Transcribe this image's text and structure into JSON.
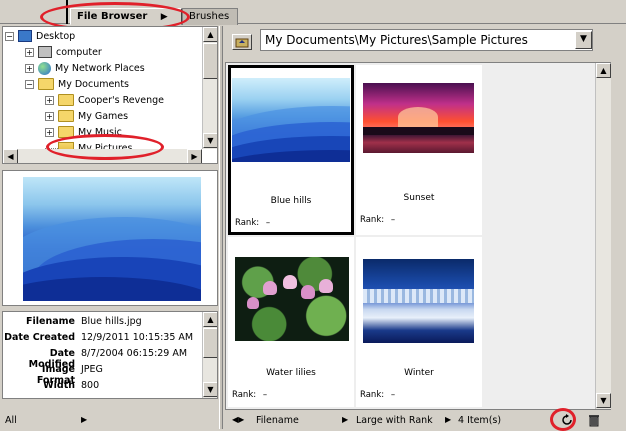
{
  "tabs": [
    {
      "label": "File Browser",
      "arrow": "▶"
    },
    {
      "label": "Brushes"
    }
  ],
  "tree": {
    "items": [
      {
        "label": "Desktop",
        "icon": "desktop-icon"
      },
      {
        "label": "computer",
        "icon": "computer-icon"
      },
      {
        "label": "My Network Places",
        "icon": "network-icon"
      },
      {
        "label": "My Documents",
        "icon": "folder-icon"
      },
      {
        "label": "Cooper's Revenge",
        "icon": "folder-icon"
      },
      {
        "label": "My Games",
        "icon": "folder-icon"
      },
      {
        "label": "My Music",
        "icon": "folder-icon"
      },
      {
        "label": "My Pictures",
        "icon": "pictures-folder-icon"
      }
    ]
  },
  "path": {
    "value": "My Documents\\My Pictures\\Sample Pictures"
  },
  "metadata": [
    {
      "key": "Filename",
      "value": "Blue hills.jpg"
    },
    {
      "key": "Date Created",
      "value": "12/9/2011 10:15:35 AM"
    },
    {
      "key": "Date Modified",
      "value": "8/7/2004 06:15:29 AM"
    },
    {
      "key": "Image Format",
      "value": "JPEG"
    },
    {
      "key": "Width",
      "value": "800"
    }
  ],
  "left_status": {
    "label": "All",
    "arrow": "▶"
  },
  "thumbnails": [
    {
      "caption": "Blue hills",
      "rank_label": "Rank:",
      "rank_value": "–",
      "selected": true
    },
    {
      "caption": "Sunset",
      "rank_label": "Rank:",
      "rank_value": "–",
      "selected": false
    },
    {
      "caption": "Water lilies",
      "rank_label": "Rank:",
      "rank_value": "–",
      "selected": false
    },
    {
      "caption": "Winter",
      "rank_label": "Rank:",
      "rank_value": "–",
      "selected": false
    }
  ],
  "status_bar": {
    "sort": "Filename",
    "view": "Large with Rank",
    "count": "4 Item(s)"
  },
  "colors": {
    "panel_bg": "#d4d0c8",
    "highlight_ring": "#e0202a"
  }
}
